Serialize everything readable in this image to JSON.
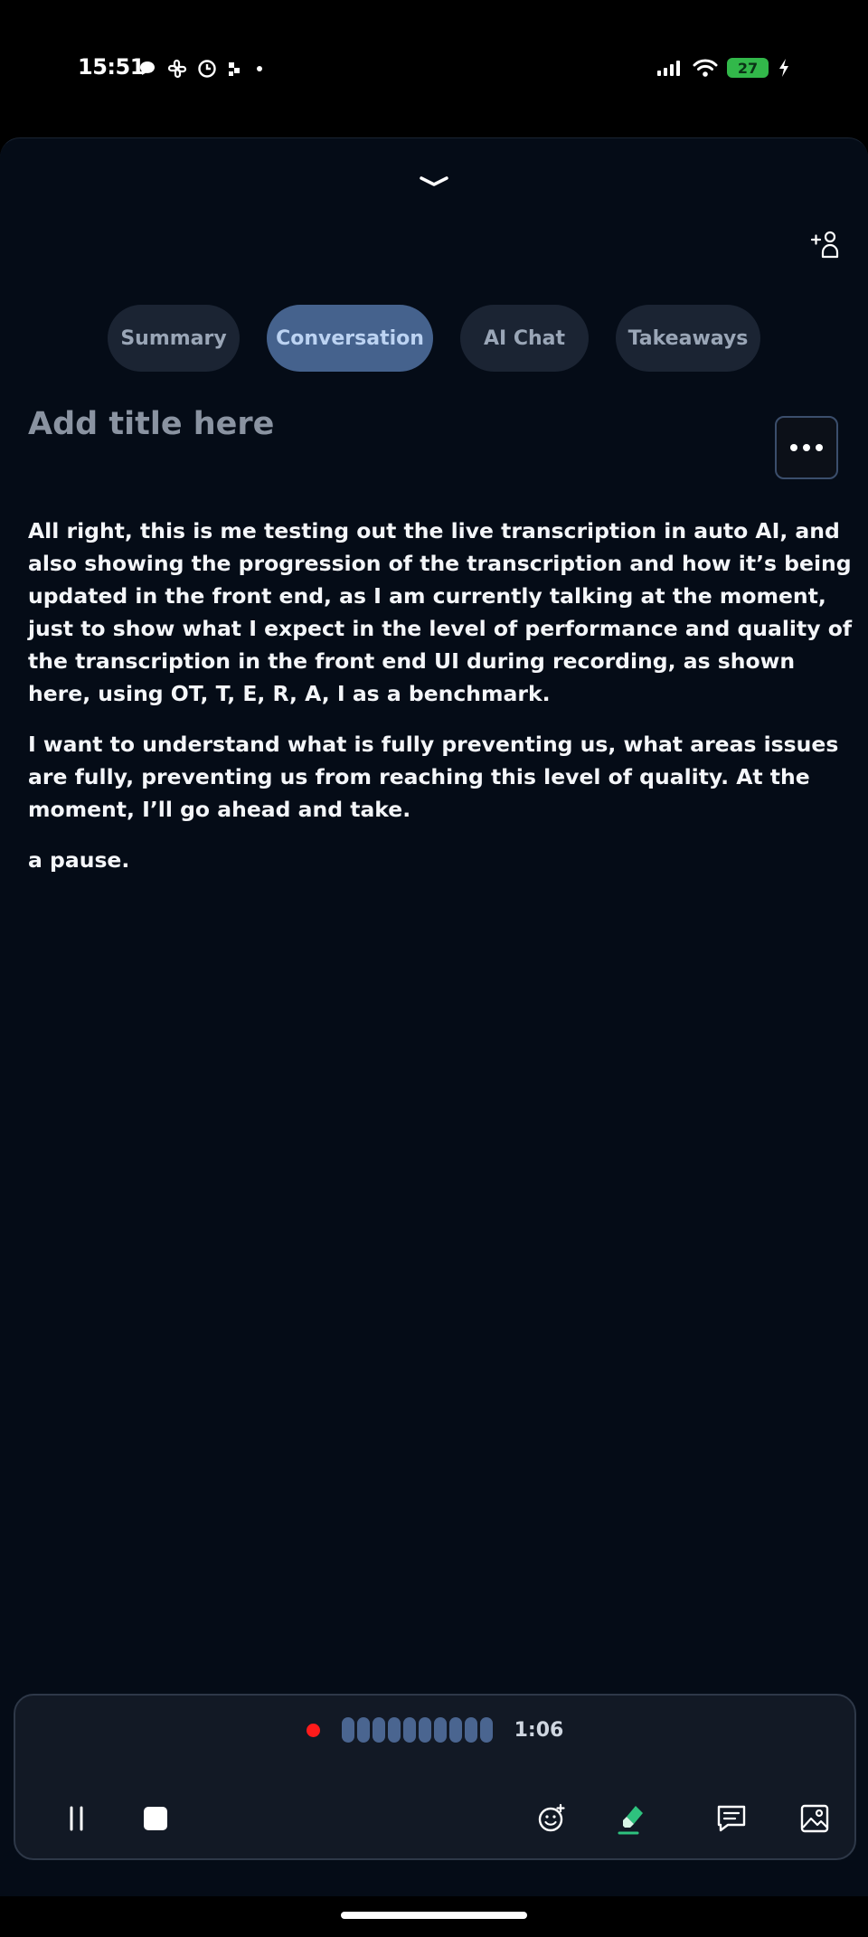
{
  "status_bar": {
    "time": "15:51",
    "battery": "27",
    "icons": [
      "chat-bubble-icon",
      "slack-icon",
      "clock-icon",
      "app-icon",
      "dot-icon",
      "signal-icon",
      "wifi-icon",
      "battery-icon",
      "charging-icon"
    ]
  },
  "header": {
    "collapse_icon": "chevron-down-icon",
    "add_participant_icon": "add-person-icon"
  },
  "tabs": [
    {
      "label": "Summary",
      "active": false
    },
    {
      "label": "Conversation",
      "active": true
    },
    {
      "label": "AI Chat",
      "active": false
    },
    {
      "label": "Takeaways",
      "active": false
    }
  ],
  "title": {
    "placeholder": "Add title here"
  },
  "transcript": {
    "paragraphs": [
      "All right, this is me testing out the live transcription in auto AI, and also showing the progression of the transcription and how it’s being updated in the front end, as I am currently talking at the moment, just to show what I expect in the level of performance and quality of the transcription in the front end UI during recording, as shown here, using OT, T, E, R, A, I as a benchmark.",
      "I want to understand what is fully preventing us, what areas issues are fully, preventing us from reaching this level of quality. At the moment, I’ll go ahead and take.",
      "a pause."
    ]
  },
  "recorder": {
    "timer": "1:06",
    "recording_color": "#ff1b1b",
    "controls": [
      "pause-icon",
      "stop-icon",
      "emoji-add-icon",
      "highlighter-icon",
      "comment-icon",
      "image-icon"
    ]
  },
  "colors": {
    "background": "#050c17",
    "tab_active": "#45628d",
    "tab_inactive": "#1b2433",
    "accent_green": "#2ec27e"
  }
}
